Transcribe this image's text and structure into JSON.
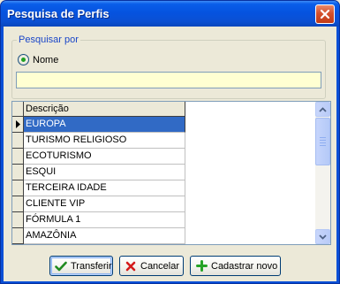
{
  "window": {
    "title": "Pesquisa de Perfis"
  },
  "search": {
    "group_label": "Pesquisar por",
    "radio_label": "Nome",
    "input_value": "",
    "input_placeholder": ""
  },
  "grid": {
    "column_header": "Descrição",
    "selected_index": 0,
    "rows": [
      "EUROPA",
      "TURISMO RELIGIOSO",
      "ECOTURISMO",
      "ESQUI",
      "TERCEIRA IDADE",
      "CLIENTE VIP",
      "FÓRMULA 1",
      "AMAZÔNIA"
    ]
  },
  "buttons": {
    "transferir": "Transferir",
    "cancelar": "Cancelar",
    "cadastrar_novo": "Cadastrar novo"
  },
  "colors": {
    "title_bar": "#0553e0",
    "selection": "#316ac5",
    "input_background": "#ffffd2",
    "group_label": "#1a46c8"
  },
  "icons": {
    "close": "close-icon",
    "transferir": "checkmark-icon",
    "cancelar": "x-icon",
    "cadastrar_novo": "plus-icon",
    "row_indicator": "row-pointer-icon"
  }
}
